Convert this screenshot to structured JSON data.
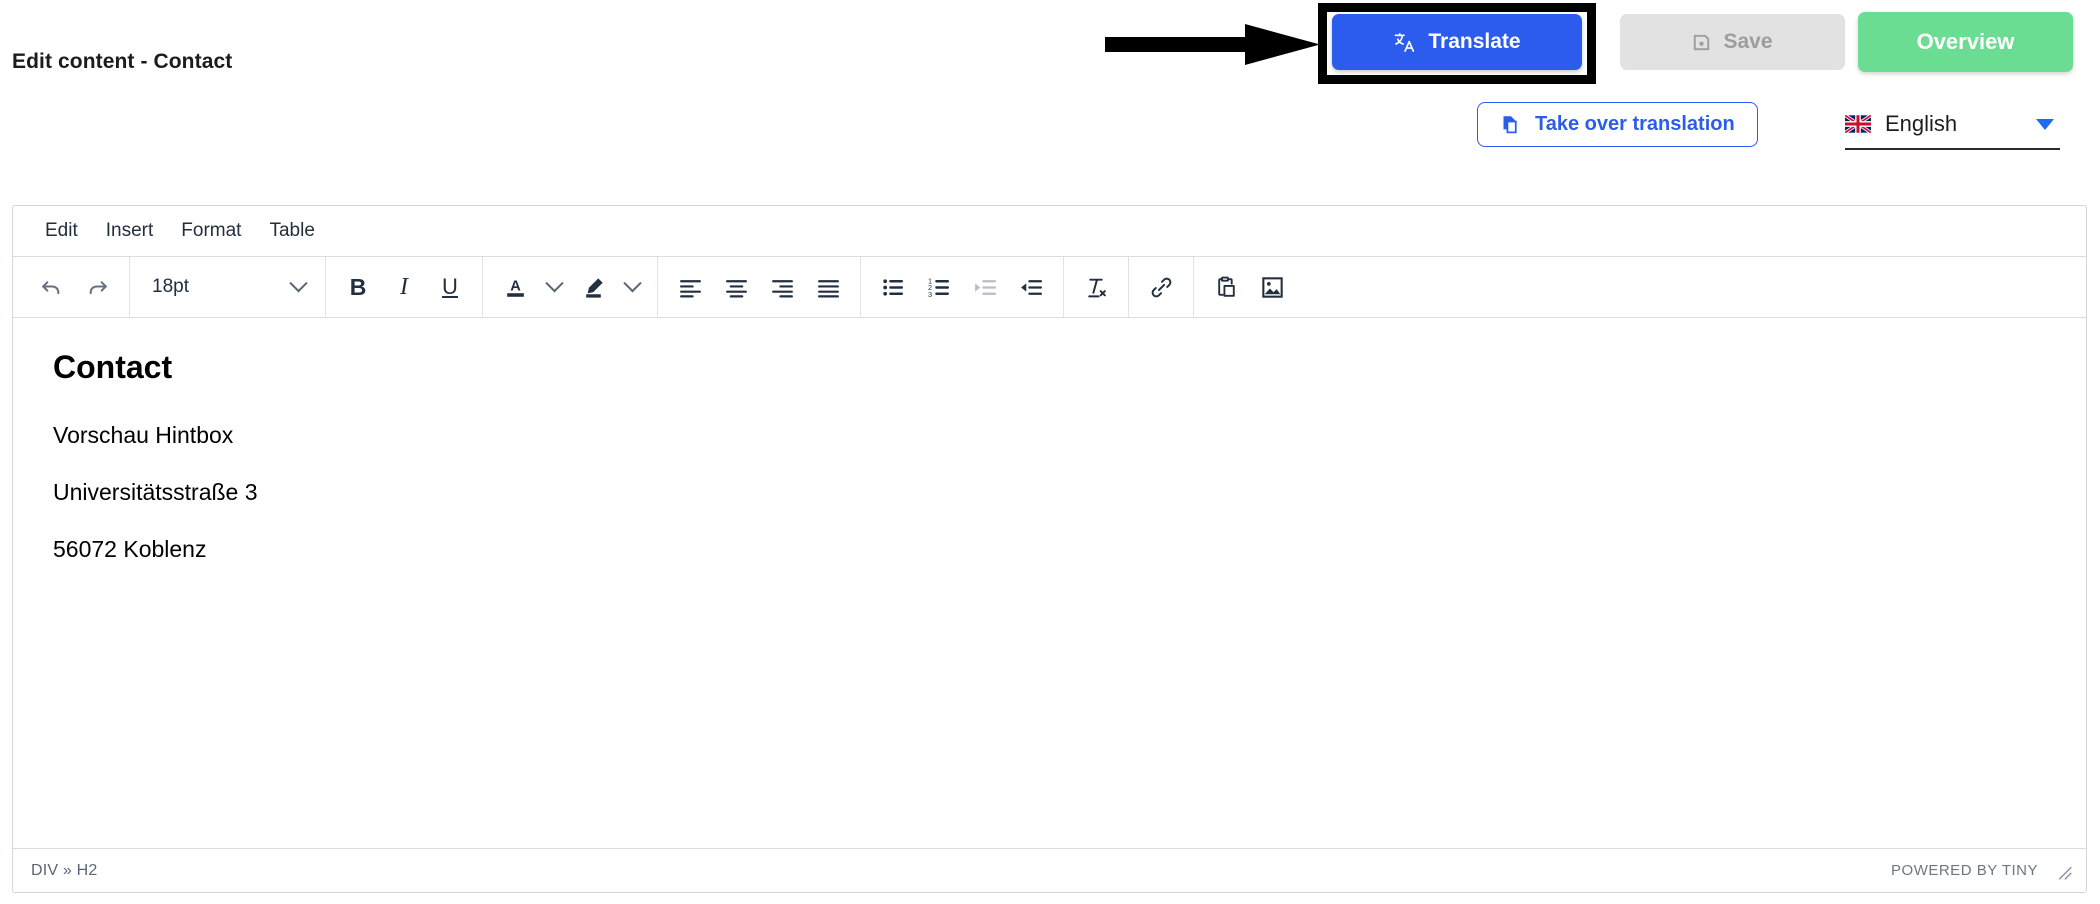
{
  "header": {
    "page_title": "Edit content - Contact",
    "actions": {
      "translate_label": "Translate",
      "translate_icon": "translate-icon",
      "translate_color": "#2b5ced",
      "save_label": "Save",
      "save_icon": "floppy-disk-icon",
      "save_color": "#e2e2e2",
      "overview_label": "Overview",
      "overview_color": "#6bdd92",
      "take_over_label": "Take over translation",
      "take_over_icon": "copy-pages-icon"
    },
    "language": {
      "selected": "English",
      "flag_icon": "uk-flag-icon",
      "caret_icon": "chevron-down-icon"
    },
    "annotation": {
      "arrow_icon": "right-arrow-icon",
      "highlight_color": "#000000"
    }
  },
  "editor": {
    "menubar": [
      "Edit",
      "Insert",
      "Format",
      "Table"
    ],
    "toolbar": {
      "undo": "undo-icon",
      "redo": "redo-icon",
      "fontsize_value": "18pt",
      "bold": "B",
      "italic": "I",
      "underline": "U",
      "forecolor": "text-color-icon",
      "backcolor": "highlight-color-icon",
      "align_left": "align-left-icon",
      "align_center": "align-center-icon",
      "align_right": "align-right-icon",
      "align_justify": "align-justify-icon",
      "bullist": "bulleted-list-icon",
      "numlist": "numbered-list-icon",
      "outdent": "outdent-icon",
      "indent": "indent-icon",
      "removeformat": "remove-formatting-icon",
      "link": "link-icon",
      "paste": "paste-icon",
      "image": "insert-image-icon"
    },
    "content": {
      "heading": "Contact",
      "paragraphs": [
        "Vorschau Hintbox",
        "Universitätsstraße 3",
        "56072 Koblenz"
      ]
    },
    "statusbar": {
      "path": "DIV » H2",
      "branding": "POWERED BY TINY",
      "resize_icon": "resize-handle-icon"
    }
  }
}
